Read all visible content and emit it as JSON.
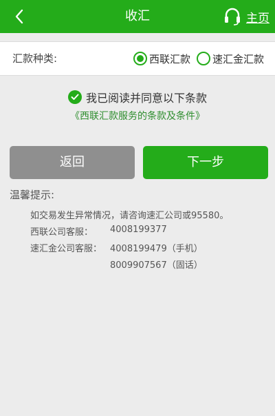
{
  "header": {
    "title": "收汇",
    "home_label": "主页",
    "icons": {
      "back": "chevron-left-icon",
      "home": "headset-icon"
    },
    "bg_color": "#24ac1a"
  },
  "remit_type": {
    "label": "汇款种类:",
    "options": [
      {
        "label": "西联汇款",
        "selected": true
      },
      {
        "label": "速汇金汇款",
        "selected": false
      }
    ]
  },
  "agreement": {
    "text": "我已阅读并同意以下条款",
    "link_text": "《西联汇款服务的条款及条件》",
    "checked": true
  },
  "actions": {
    "back_label": "返回",
    "next_label": "下一步"
  },
  "tips": {
    "title": "温馨提示:",
    "line1": "如交易发生异常情况，请咨询速汇公司或95580。",
    "western_union_label": "西联公司客服：",
    "western_union_phone": "4008199377",
    "moneygram_label": "速汇金公司客服：",
    "moneygram_phone1": "4008199479（手机）",
    "moneygram_phone2": "8009907567（固话）"
  }
}
